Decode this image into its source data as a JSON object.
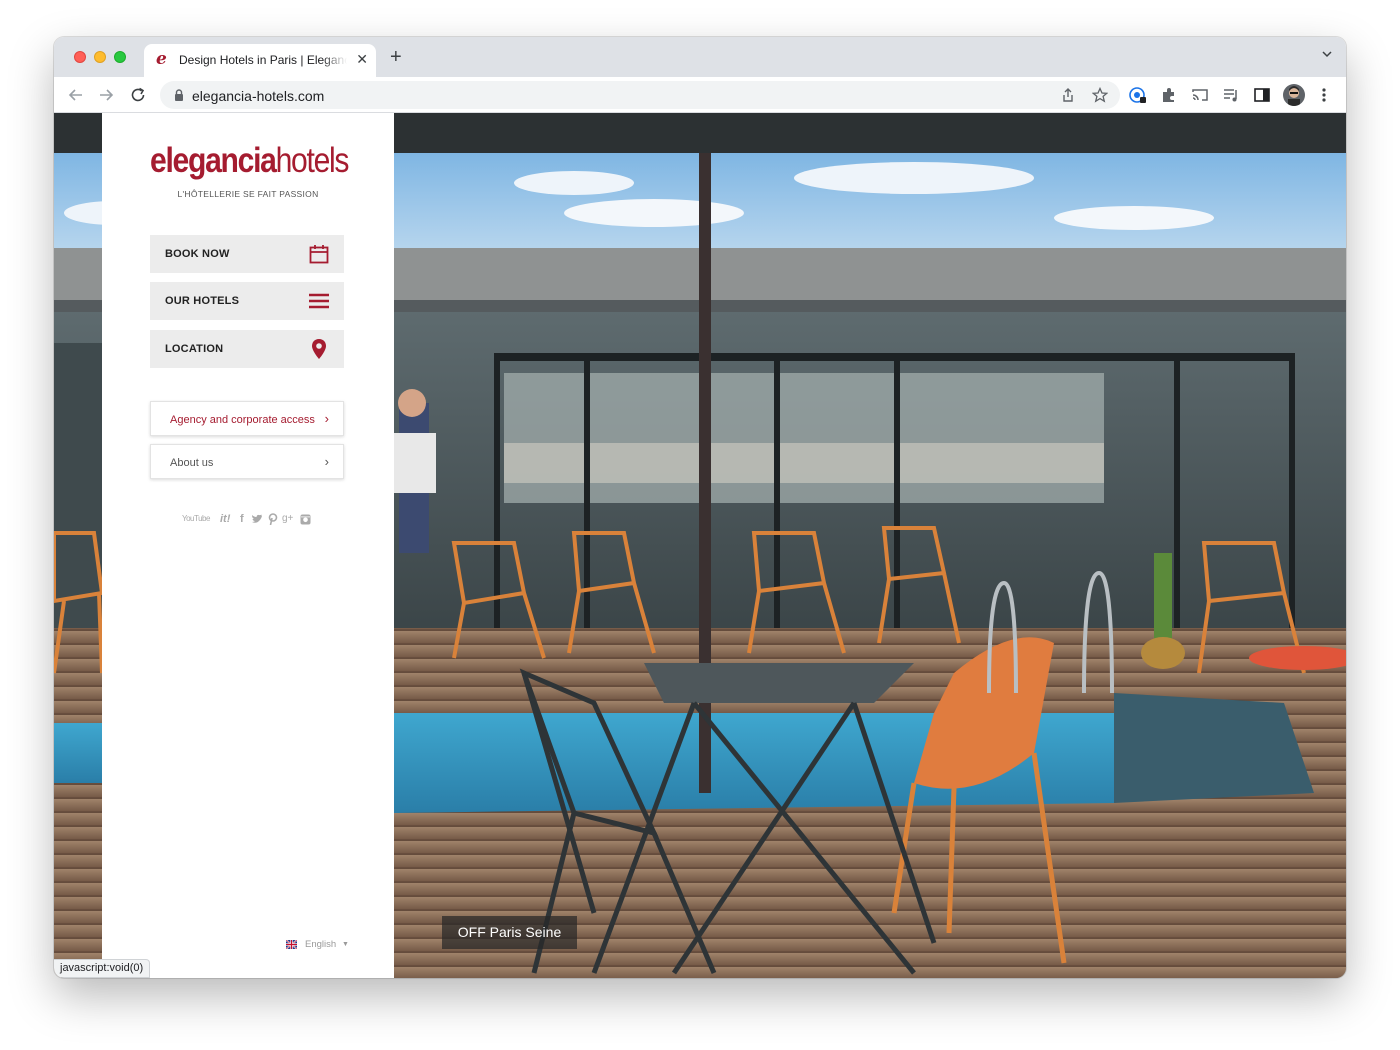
{
  "browser": {
    "tab_title": "Design Hotels in Paris | Elegancia Hotels",
    "tab_favicon": "e",
    "url": "elegancia-hotels.com",
    "status_text": "javascript:void(0)"
  },
  "brand": {
    "name_bold": "elegancia",
    "name_light": "hotels",
    "tagline": "L'HÔTELLERIE SE FAIT PASSION",
    "accent_color": "#a51c30"
  },
  "menu": [
    {
      "label": "BOOK NOW",
      "icon": "calendar-icon"
    },
    {
      "label": "OUR HOTELS",
      "icon": "hamburger-icon"
    },
    {
      "label": "LOCATION",
      "icon": "map-pin-icon"
    }
  ],
  "links": [
    {
      "label": "Agency and corporate access",
      "color": "#a51c30"
    },
    {
      "label": "About us",
      "color": "#555555"
    }
  ],
  "social_icons": [
    "youtube-icon",
    "instagram-it-icon",
    "facebook-icon",
    "twitter-icon",
    "pinterest-icon",
    "google-plus-icon",
    "instagram-icon"
  ],
  "social_text": {
    "youtube": "YouTube",
    "it": "it!",
    "fb": "f",
    "gplus": "g+"
  },
  "language": {
    "selected": "English",
    "flag": "uk-flag-icon"
  },
  "hero": {
    "caption": "OFF Paris Seine"
  }
}
